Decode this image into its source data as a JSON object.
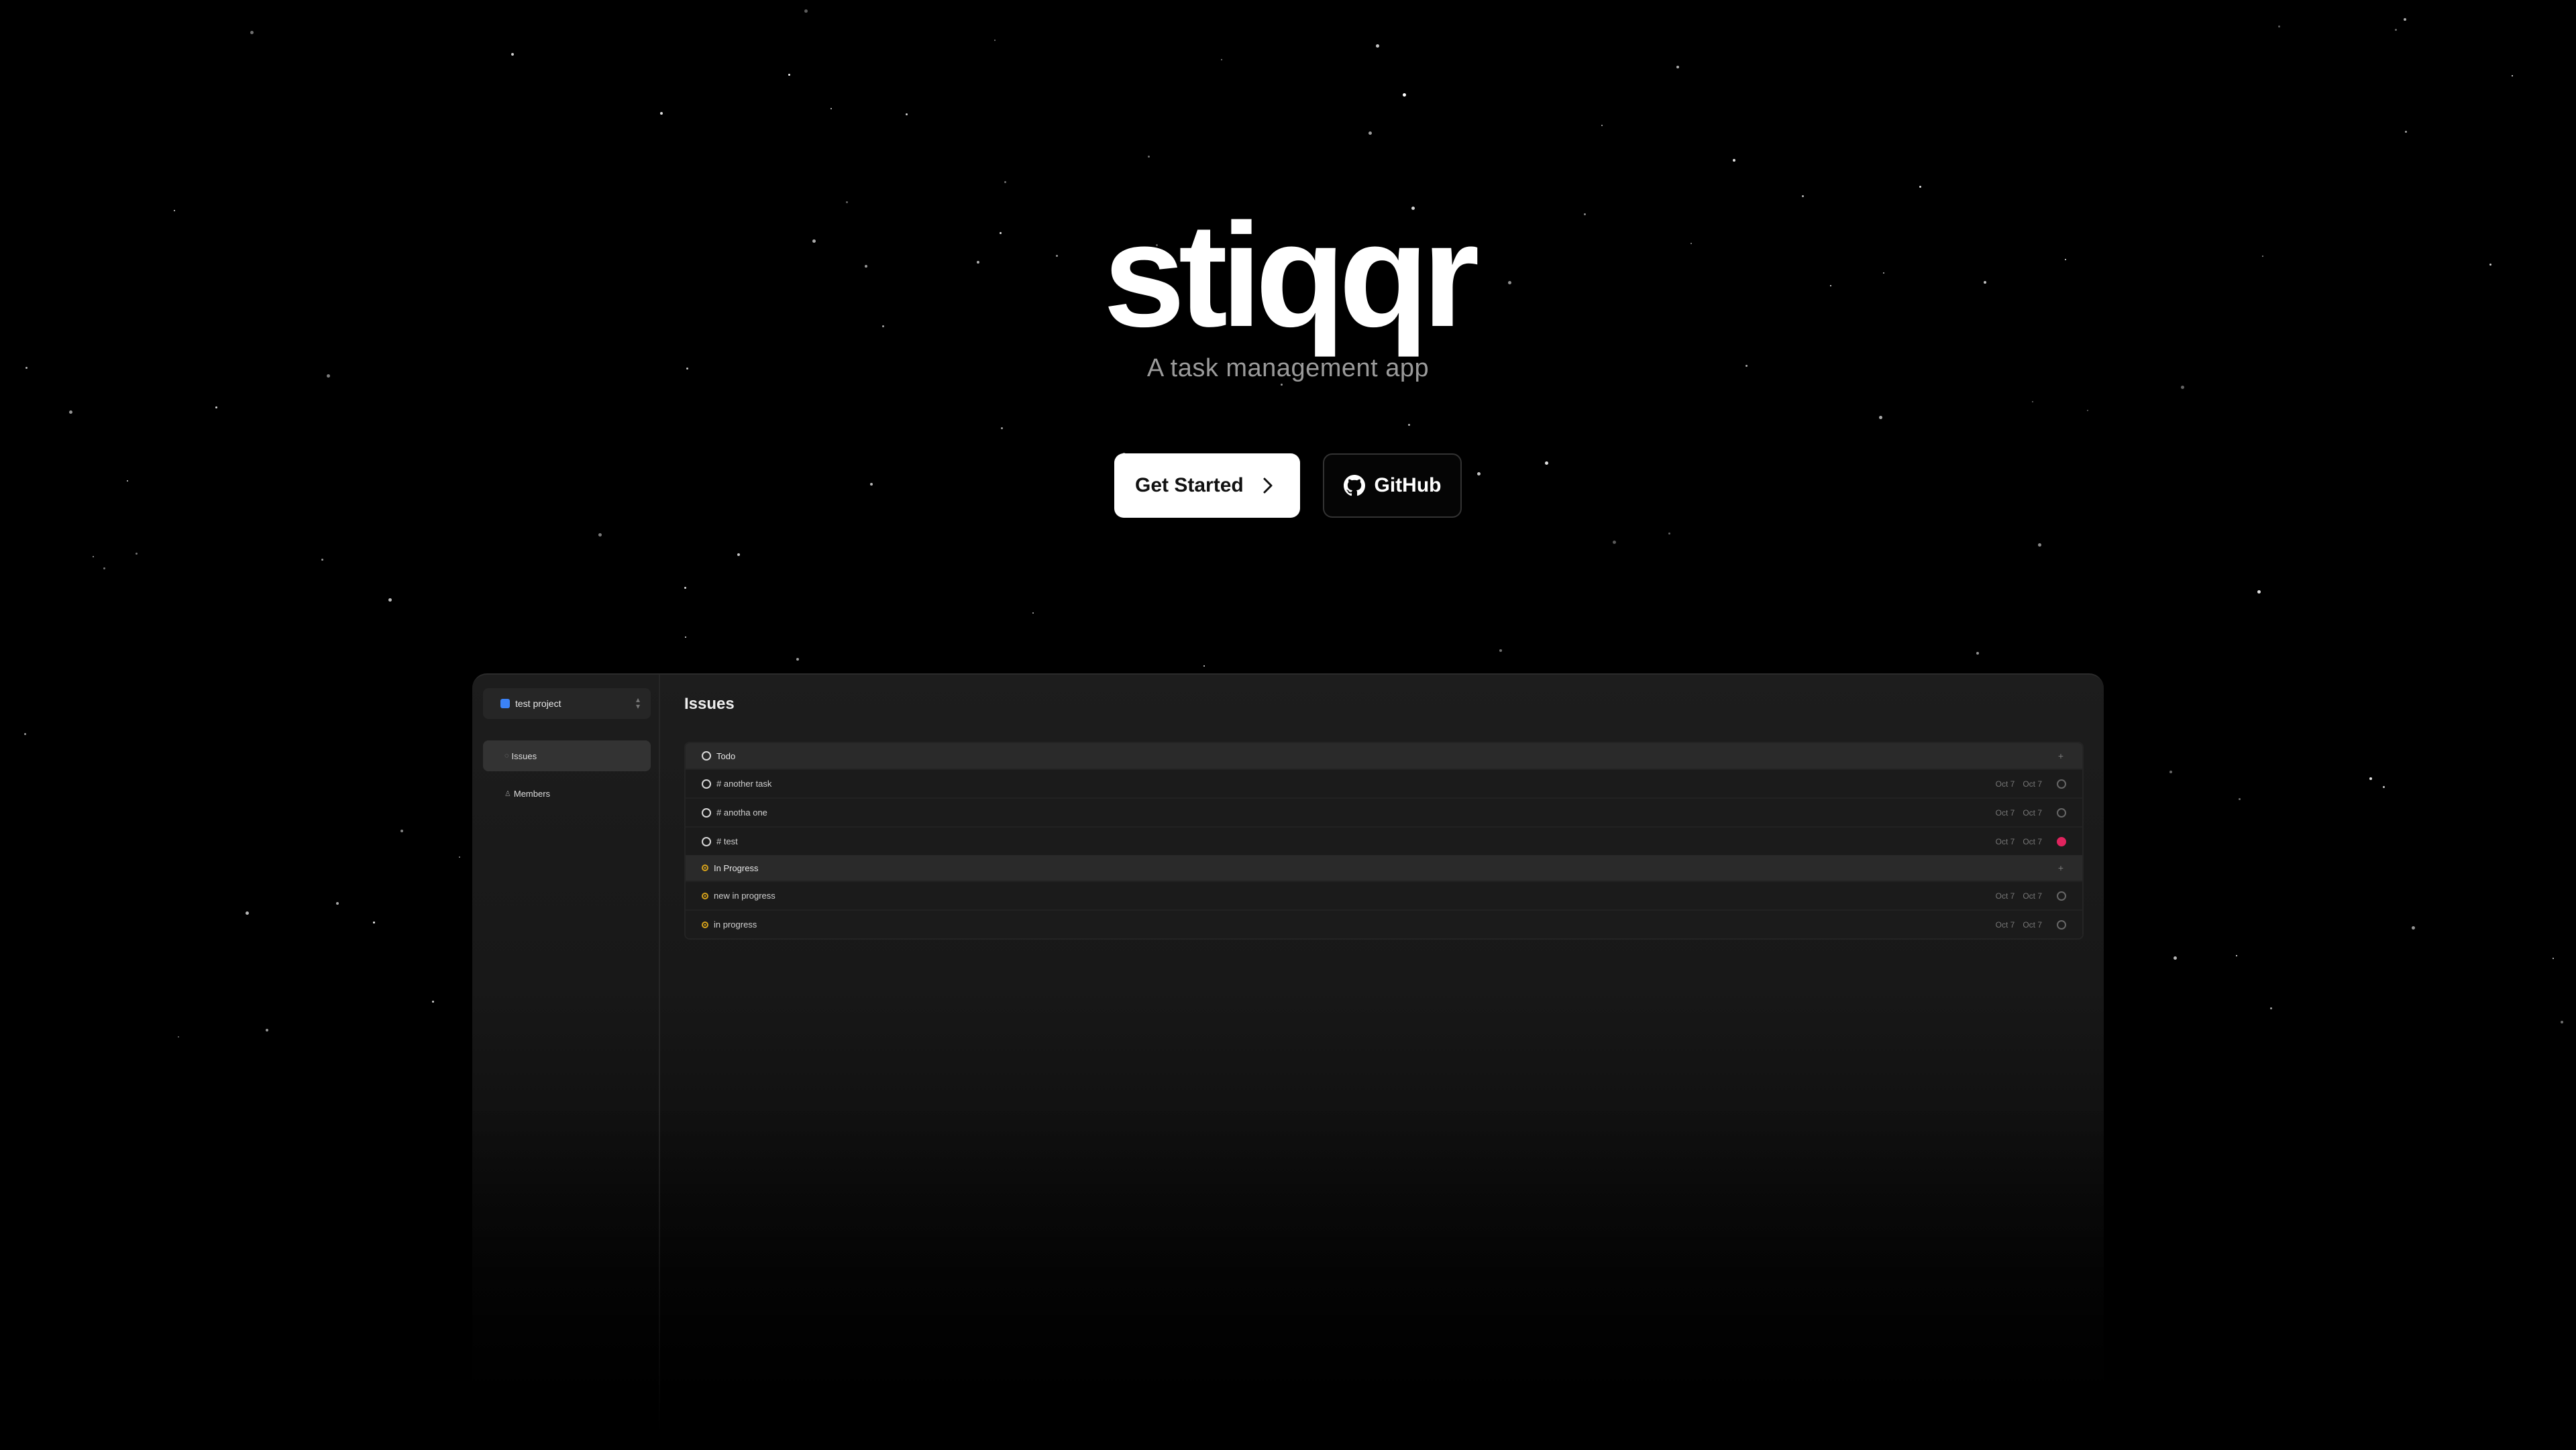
{
  "brand": {
    "name": "stiqqr",
    "tagline": "A task management app"
  },
  "cta": {
    "primary_label": "Get Started",
    "secondary_label": "GitHub"
  },
  "app": {
    "project_name": "test project",
    "nav": [
      {
        "label": "Issues",
        "icon": "issues-icon",
        "active": true
      },
      {
        "label": "Members",
        "icon": "members-icon",
        "active": false
      }
    ],
    "page_title": "Issues",
    "groups": [
      {
        "label": "Todo",
        "status": "todo",
        "add_icon": "+",
        "issues": [
          {
            "title": "# another task",
            "created": "Oct 7",
            "updated": "Oct 7",
            "status": "open"
          },
          {
            "title": "# anotha one",
            "created": "Oct 7",
            "updated": "Oct 7",
            "status": "open"
          },
          {
            "title": "# test",
            "created": "Oct 7",
            "updated": "Oct 7",
            "status": "urgent"
          }
        ]
      },
      {
        "label": "In Progress",
        "status": "in-progress",
        "add_icon": "+",
        "issues": [
          {
            "title": "new in progress",
            "created": "Oct 7",
            "updated": "Oct 7",
            "status": "open"
          },
          {
            "title": "in progress",
            "created": "Oct 7",
            "updated": "Oct 7",
            "status": "open"
          }
        ]
      }
    ]
  },
  "colors": {
    "background": "#000000",
    "accent_progress": "#d8a31b",
    "urgent": "#e0245e",
    "project_dot": "#3b82f6"
  }
}
